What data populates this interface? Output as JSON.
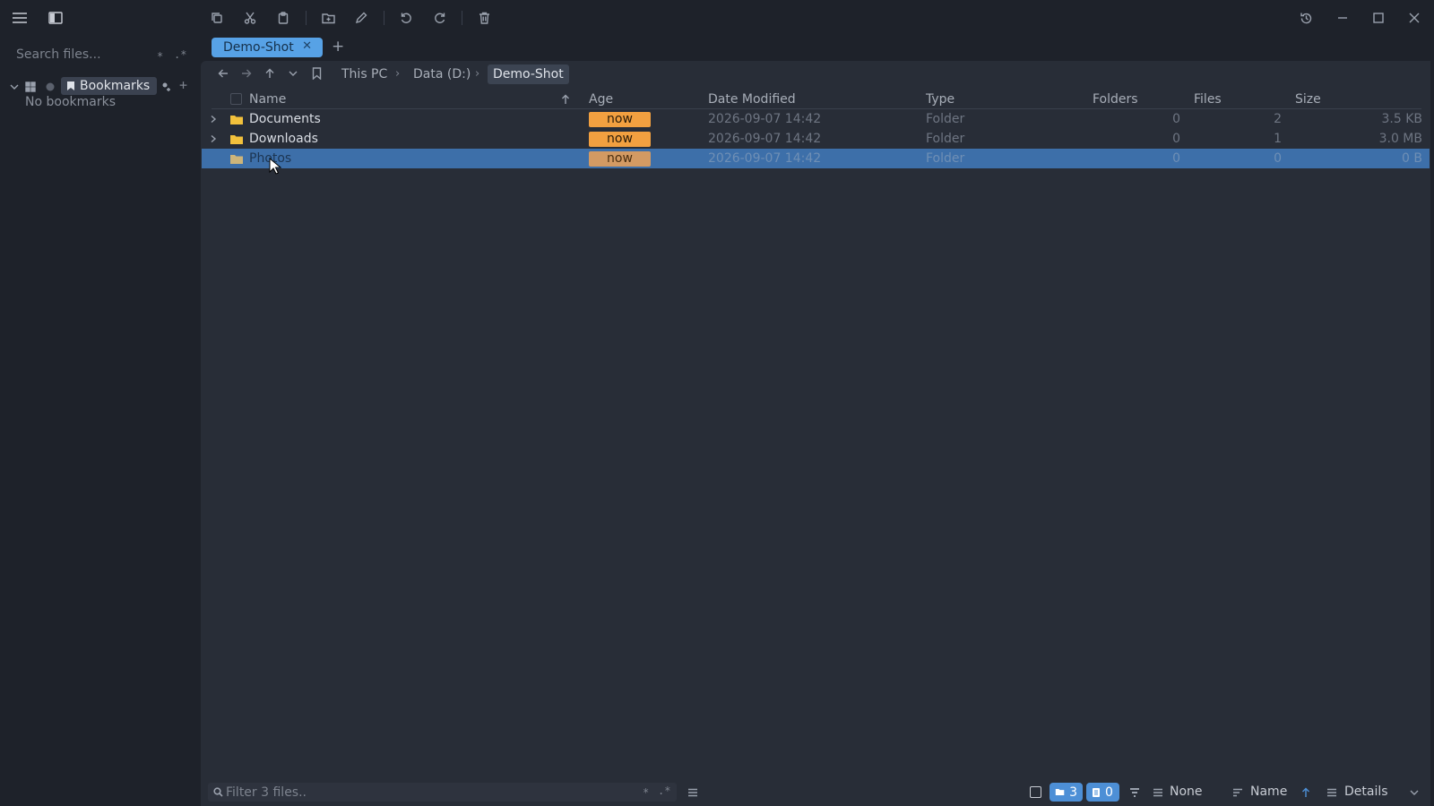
{
  "toolbar": {
    "icons": [
      "menu-icon",
      "sidebar-toggle-icon",
      "copy-icon",
      "cut-icon",
      "paste-icon",
      "new-folder-icon",
      "rename-icon",
      "undo-icon",
      "redo-icon",
      "delete-icon",
      "history-icon",
      "minimize-icon",
      "maximize-icon",
      "close-icon"
    ]
  },
  "sidebar": {
    "search_placeholder": "Search files...",
    "glob_glyph": "*",
    "regex_glyph": ".*",
    "bookmarks_label": "Bookmarks",
    "add_glyph": "+",
    "empty_text": "No bookmarks"
  },
  "tabs": [
    {
      "label": "Demo-Shot",
      "close": "✕",
      "active": true
    }
  ],
  "new_tab_label": "+",
  "breadcrumb": {
    "items": [
      "This PC",
      "Data (D:)",
      "Demo-Shot"
    ],
    "separator": "›"
  },
  "columns": {
    "name": "Name",
    "age": "Age",
    "date_modified": "Date Modified",
    "type": "Type",
    "folders": "Folders",
    "files": "Files",
    "size": "Size"
  },
  "rows": [
    {
      "name": "Documents",
      "age": "now",
      "date": "2026-09-07 14:42",
      "type": "Folder",
      "folders": "0",
      "files": "2",
      "size": "3.5 KB",
      "selected": false
    },
    {
      "name": "Downloads",
      "age": "now",
      "date": "2026-09-07 14:42",
      "type": "Folder",
      "folders": "0",
      "files": "1",
      "size": "3.0 MB",
      "selected": false
    },
    {
      "name": "Photos",
      "age": "now",
      "date": "2026-09-07 14:42",
      "type": "Folder",
      "folders": "0",
      "files": "0",
      "size": "0 B",
      "selected": true
    }
  ],
  "statusbar": {
    "filter_placeholder": "Filter 3 files..",
    "glob_glyph": "*",
    "regex_glyph": ".*",
    "folder_count": "3",
    "file_count": "0",
    "group_label": "None",
    "sort_label": "Name",
    "view_label": "Details"
  },
  "colors": {
    "accent": "#57a2e6",
    "selection": "#3d6fa9",
    "age_badge": "#f2a040",
    "folder_icon": "#f2c13c"
  }
}
